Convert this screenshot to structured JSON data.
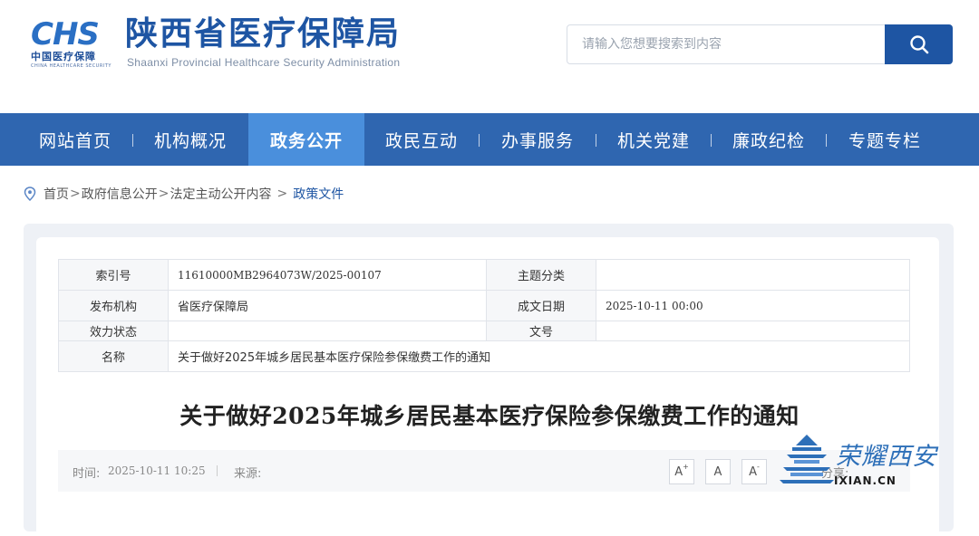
{
  "header": {
    "logo_text": "CHS",
    "logo_cn": "中国医疗保障",
    "logo_en": "CHINA HEALTHCARE SECURITY",
    "title": "陕西省医疗保障局",
    "subtitle": "Shaanxi Provincial Healthcare Security Administration"
  },
  "search": {
    "placeholder": "请输入您想要搜索到内容",
    "icon": "search-icon"
  },
  "nav": {
    "items": [
      "网站首页",
      "机构概况",
      "政务公开",
      "政民互动",
      "办事服务",
      "机关党建",
      "廉政纪检",
      "专题专栏"
    ],
    "active_index": 2
  },
  "breadcrumb": {
    "icon": "location-pin-icon",
    "items": [
      "首页",
      "政府信息公开",
      "法定主动公开内容"
    ],
    "separator": ">",
    "current": "政策文件"
  },
  "meta": {
    "index_label": "索引号",
    "index_value": "11610000MB2964073W/2025-00107",
    "topic_label": "主题分类",
    "topic_value": "",
    "publisher_label": "发布机构",
    "publisher_value": "省医疗保障局",
    "date_label": "成文日期",
    "date_value": "2025-10-11 00:00",
    "status_label": "效力状态",
    "status_value": "",
    "docno_label": "文号",
    "docno_value": "",
    "name_label": "名称",
    "name_value": "关于做好2025年城乡居民基本医疗保险参保缴费工作的通知"
  },
  "article": {
    "title": "关于做好2025年城乡居民基本医疗保险参保缴费工作的通知",
    "time_label": "时间:",
    "time_value": "2025-10-11 10:25",
    "source_label": "来源:",
    "font_buttons": [
      "A",
      "A",
      "A"
    ],
    "share_label": "分享:"
  },
  "watermark": {
    "text": "荣耀西安",
    "url": "IXIAN.CN"
  },
  "colors": {
    "brand_blue": "#1e55a3",
    "nav_bg": "#2f66b0",
    "nav_active": "#4a8fdc"
  }
}
